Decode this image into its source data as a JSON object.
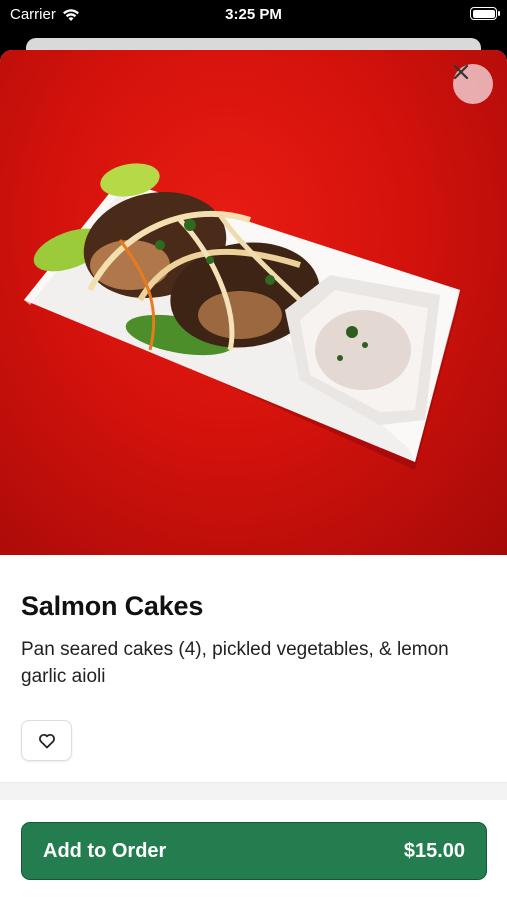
{
  "status_bar": {
    "carrier": "Carrier",
    "time": "3:25 PM",
    "icons": [
      "wifi-icon",
      "battery-icon"
    ]
  },
  "item": {
    "image_alt_icon": "food-photo",
    "name": "Salmon Cakes",
    "description": "Pan seared cakes (4), pickled vegetables, & lemon garlic aioli",
    "favorite_icon": "heart-icon"
  },
  "actions": {
    "close_icon": "close-icon",
    "add_label": "Add to Order",
    "price": "$15.00"
  },
  "colors": {
    "accent": "#237d4e",
    "photo_background": "#d4120c"
  }
}
